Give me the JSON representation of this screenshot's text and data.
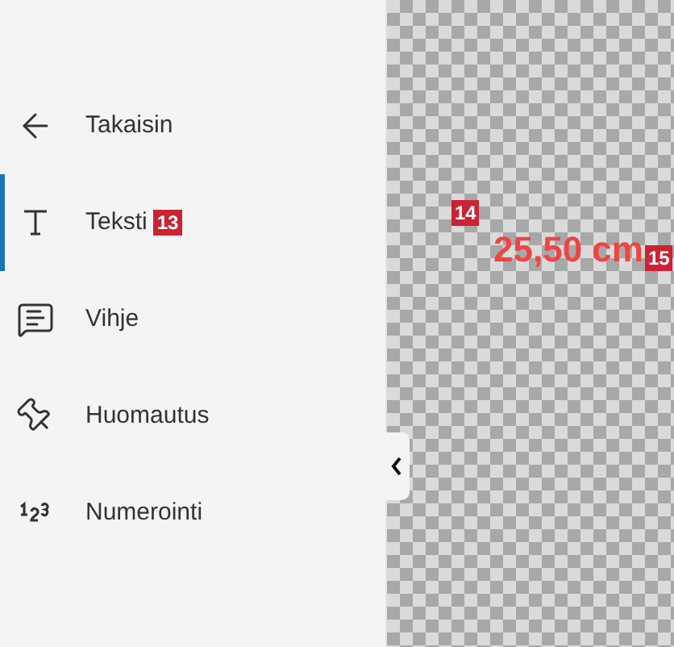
{
  "menu": [
    {
      "kind": "back",
      "label": "Takaisin",
      "selected": false
    },
    {
      "kind": "text",
      "label": "Teksti",
      "selected": true,
      "badge": "13"
    },
    {
      "kind": "hint",
      "label": "Vihje",
      "selected": false
    },
    {
      "kind": "note",
      "label": "Huomautus",
      "selected": false
    },
    {
      "kind": "numbering",
      "label": "Numerointi",
      "selected": false
    }
  ],
  "canvas": {
    "badges": [
      "14",
      "15"
    ],
    "measurement": "25,50 cm"
  }
}
